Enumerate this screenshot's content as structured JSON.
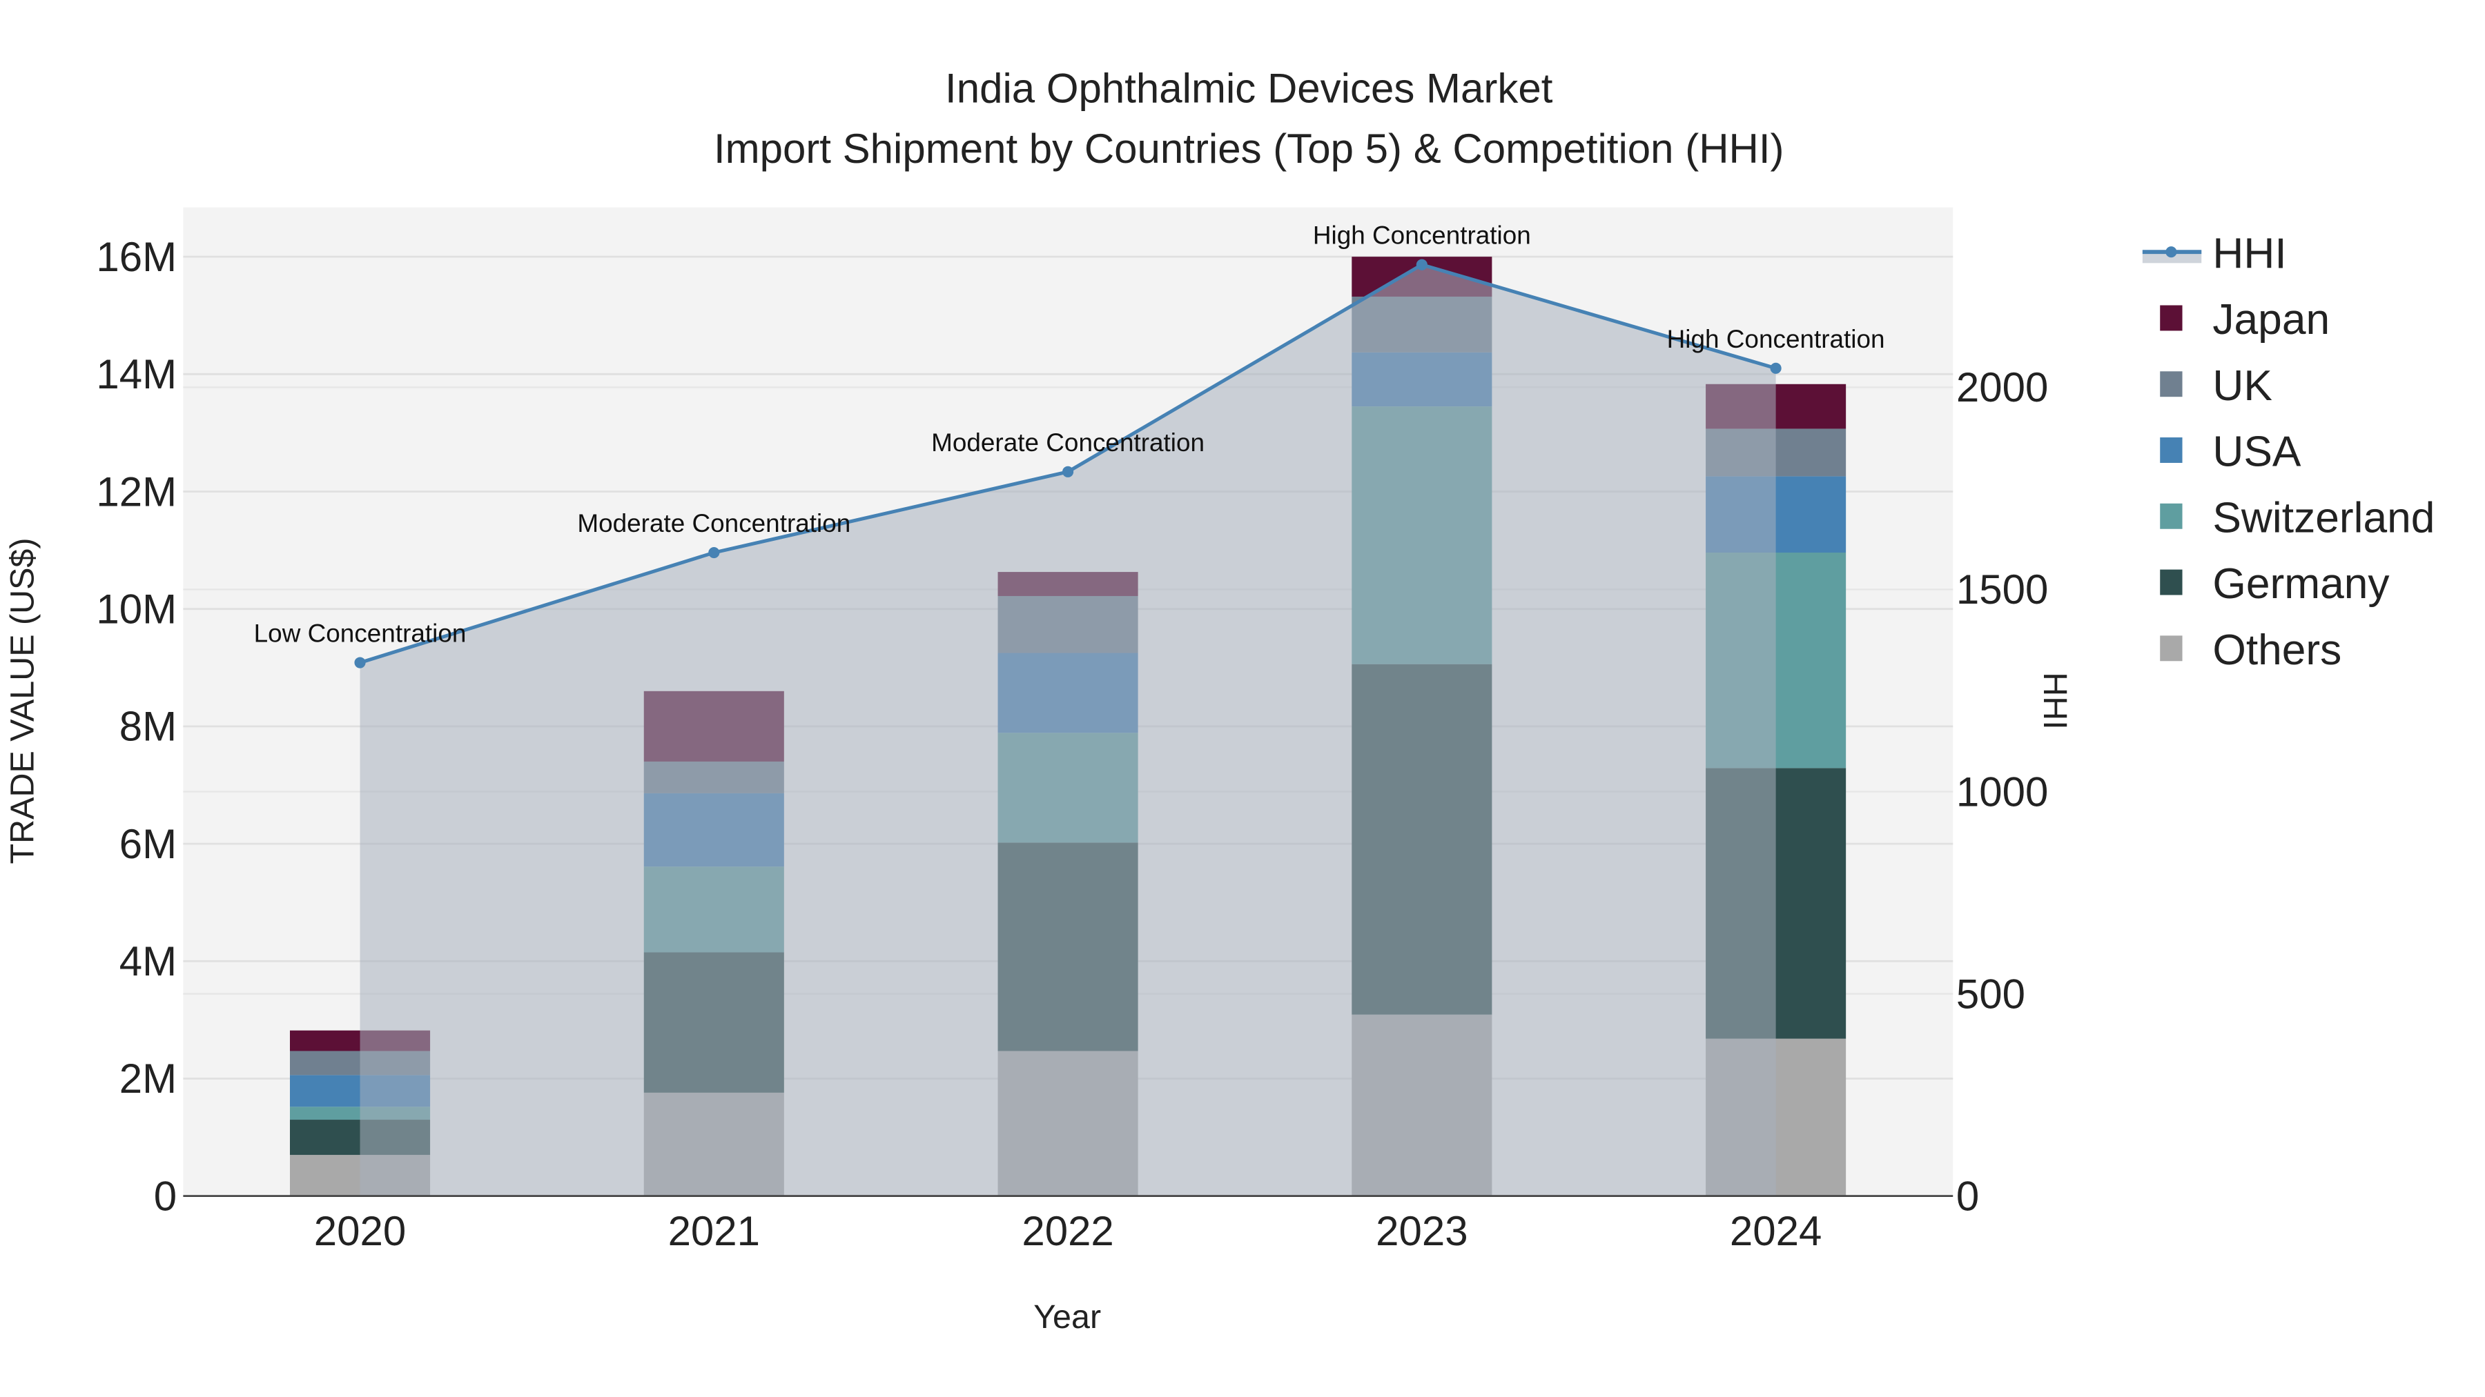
{
  "chart_data": {
    "type": "bar",
    "title": "India Ophthalmic Devices Market",
    "subtitle": "Import Shipment by Countries (Top 5) & Competition (HHI)",
    "xlabel": "Year",
    "ylabel": "TRADE VALUE (US$)",
    "y2label": "HHI",
    "categories": [
      "2020",
      "2021",
      "2022",
      "2023",
      "2024"
    ],
    "ylim": [
      0,
      16800000
    ],
    "y2lim": [
      0,
      2450
    ],
    "yticks": [
      0,
      2000000,
      4000000,
      6000000,
      8000000,
      10000000,
      12000000,
      14000000,
      16000000
    ],
    "ytick_labels": [
      "0",
      "2M",
      "4M",
      "6M",
      "8M",
      "10M",
      "12M",
      "14M",
      "16M"
    ],
    "y2ticks": [
      0,
      500,
      1000,
      1500,
      2000
    ],
    "y2tick_labels": [
      "0",
      "500",
      "1000",
      "1500",
      "2000"
    ],
    "stacked": true,
    "series": [
      {
        "name": "Others",
        "color": "#a9a9a9",
        "values": [
          700000,
          1760000,
          2470000,
          3090000,
          2680000
        ]
      },
      {
        "name": "Germany",
        "color": "#2f4f4f",
        "values": [
          600000,
          2390000,
          3550000,
          5970000,
          4610000
        ]
      },
      {
        "name": "Switzerland",
        "color": "#5f9ea0",
        "values": [
          220000,
          1460000,
          1870000,
          4390000,
          3670000
        ]
      },
      {
        "name": "USA",
        "color": "#4682b4",
        "values": [
          540000,
          1250000,
          1360000,
          920000,
          1300000
        ]
      },
      {
        "name": "UK",
        "color": "#708090",
        "values": [
          410000,
          540000,
          970000,
          950000,
          810000
        ]
      },
      {
        "name": "Japan",
        "color": "#5c1036",
        "values": [
          350000,
          1200000,
          410000,
          680000,
          760000
        ]
      }
    ],
    "line": {
      "name": "HHI",
      "color": "#4682b4",
      "fill": "rgba(168,176,190,0.55)",
      "values": [
        1319,
        1591,
        1791,
        2303,
        2047
      ],
      "annotations": [
        "Low Concentration",
        "Moderate Concentration",
        "Moderate Concentration",
        "High Concentration",
        "High Concentration"
      ]
    },
    "legend": {
      "placement": "right",
      "entries": [
        "HHI",
        "Japan",
        "UK",
        "USA",
        "Switzerland",
        "Germany",
        "Others"
      ]
    },
    "grid": true
  }
}
